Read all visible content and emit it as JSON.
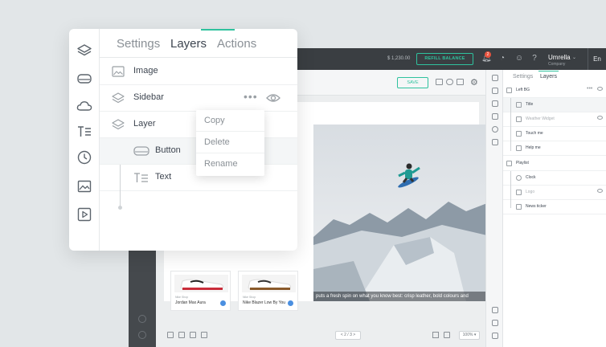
{
  "topbar": {
    "balance": "$ 1,230.00",
    "refill_label": "REFILL BALANCE",
    "notification_count": "2",
    "user_name": "Umrella",
    "user_company": "Company",
    "language": "En"
  },
  "canvas": {
    "save_label": "SAVE",
    "caption": "puts a fresh spin on what you know best: crisp leather, bold colours and",
    "cards": [
      {
        "brand": "Nike Shop",
        "name": "Jordan Max Aura"
      },
      {
        "brand": "Nike Shop",
        "name": "Nike Blazer Low By You"
      }
    ],
    "page_indicator": "< 2 / 3 >",
    "zoom": "100% ▾"
  },
  "right_panel": {
    "tabs": [
      "Settings",
      "Layers"
    ],
    "active_tab": "Layers",
    "items": [
      {
        "label": "Left BG",
        "dim": false
      },
      {
        "label": "Title",
        "dim": false
      },
      {
        "label": "Weather Widget",
        "dim": true
      },
      {
        "label": "Touch me",
        "dim": false
      },
      {
        "label": "Help me",
        "dim": false
      },
      {
        "label": "Playlist",
        "dim": false
      },
      {
        "label": "Clock",
        "dim": false
      },
      {
        "label": "Logo",
        "dim": true
      },
      {
        "label": "News ticker",
        "dim": false
      }
    ]
  },
  "popup": {
    "tabs": {
      "settings": "Settings",
      "layers": "Layers",
      "actions": "Actions"
    },
    "active_tab": "Layers",
    "layers": {
      "image": "Image",
      "sidebar": "Sidebar",
      "layer": "Layer",
      "button": "Button",
      "text": "Text"
    },
    "dots": "•••",
    "context_menu": {
      "copy": "Copy",
      "delete": "Delete",
      "rename": "Rename"
    }
  },
  "colors": {
    "accent": "#2fc29e",
    "topbar": "#3a3e42",
    "badge": "#e8533e"
  }
}
